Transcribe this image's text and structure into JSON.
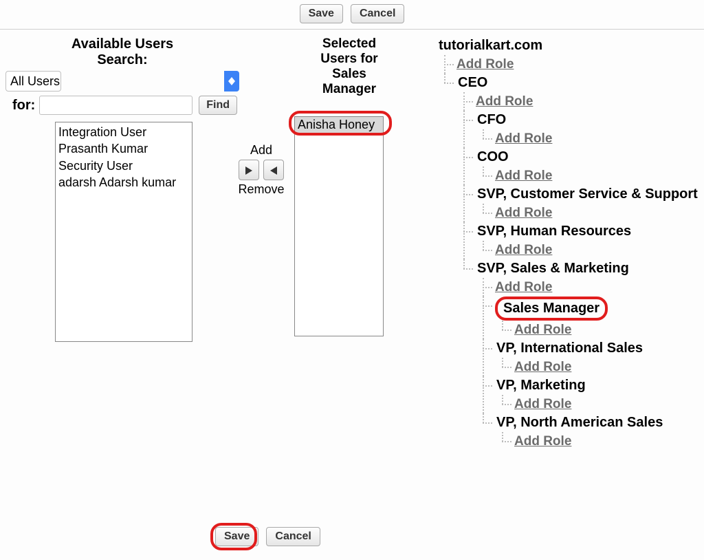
{
  "buttons": {
    "save": "Save",
    "cancel": "Cancel",
    "find": "Find",
    "add": "Add",
    "remove": "Remove"
  },
  "available": {
    "heading_line1": "Available Users",
    "heading_line2": "Search:",
    "dropdown_selected": "All Users",
    "for_label": "for:",
    "for_value": "",
    "list": [
      "Integration User",
      "Prasanth Kumar",
      "Security User",
      "adarsh Adarsh kumar"
    ]
  },
  "selected": {
    "heading_line1": "Selected",
    "heading_line2": "Users for",
    "heading_line3": "Sales",
    "heading_line4": "Manager",
    "items": [
      "Anisha Honey"
    ]
  },
  "tree": {
    "add_role_text": "Add Role",
    "root": "tutorialkart.com",
    "ceo": "CEO",
    "cfo": "CFO",
    "coo": "COO",
    "svp_cs": "SVP, Customer Service & Support",
    "svp_hr": "SVP, Human Resources",
    "svp_sm": "SVP, Sales & Marketing",
    "sales_mgr": "Sales Manager",
    "vp_intl": "VP, International Sales",
    "vp_mkt": "VP, Marketing",
    "vp_na": "VP, North American Sales"
  }
}
